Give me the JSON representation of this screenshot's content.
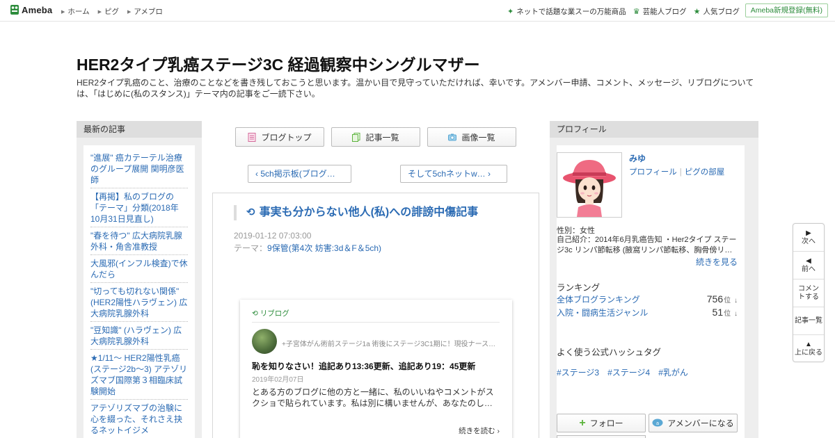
{
  "header": {
    "logo": "Ameba",
    "nav": [
      "ホーム",
      "ピグ",
      "アメブロ"
    ],
    "right_links": [
      {
        "icon": "sparkle-icon",
        "label": "ネットで話題な業スーの万能商品"
      },
      {
        "icon": "crown-icon",
        "label": "芸能人ブログ"
      },
      {
        "icon": "star-icon",
        "label": "人気ブログ"
      }
    ],
    "signup": "Ameba新規登録(無料)"
  },
  "blog": {
    "title": "HER2タイプ乳癌ステージ3C 経過観察中シングルマザー",
    "description": "HER2タイプ乳癌のこと、治療のことなどを書き残しておこうと思います。温かい目で見守っていただければ、幸いです。アメンバー申請、コメント、メッセージ、リブログについては、「はじめに(私のスタンス)」テーマ内の記事をご一読下さい。"
  },
  "recent": {
    "heading": "最新の記事",
    "items": [
      "\"進展\" 癌カテーテル治療のグループ展開 関明彦医師",
      "【再掲】私のブログの「テーマ」分類(2018年10月31日見直し)",
      "\"春を待つ\" 広大病院乳腺外科・角舎准教授",
      "大風邪(インフル検査)で休んだら",
      "\"切っても切れない関係\" (HER2陽性ハラヴェン) 広大病院乳腺外科",
      "\"豆知識\" (ハラヴェン) 広大病院乳腺外科",
      "★1/11～ HER2陽性乳癌(ステージ2b～3) アテゾリズマブ国際第３相臨床試験開始",
      "アテゾリズマブの治験に心を綴った、それさえ抉るネットイジメ"
    ]
  },
  "center": {
    "buttons": [
      {
        "icon": "blog-top-icon",
        "label": "ブログトップ"
      },
      {
        "icon": "article-list-icon",
        "label": "記事一覧"
      },
      {
        "icon": "camera-icon",
        "label": "画像一覧"
      }
    ],
    "prev": "5ch掲示板(ブログ…",
    "next": "そして5chネットw…"
  },
  "article": {
    "title": "事実も分からない他人(私)への誹謗中傷記事",
    "date": "2019-01-12 07:03:00",
    "theme_label": "テーマ：",
    "theme": "9保管(第4次 妨害:3d＆F＆5ch)"
  },
  "reblog": {
    "label": "リブログ",
    "blog_name": "+子宮体がん術前ステージ1a 術後にステージ3C1期に！現役ナース…",
    "title": "恥を知りなさい！追記あり13:36更新、追記あり19：45更新",
    "date": "2019年02月07日",
    "excerpt": "とある方のブログに他の方と一緒に、私のいいねやコメントがスクショで貼られています。私は別に構いませんが、あなたのし…",
    "more": "続きを読む"
  },
  "profile": {
    "heading": "プロフィール",
    "name": "みゆ",
    "link_profile": "プロフィール",
    "link_pig": "ピグの部屋",
    "gender": "性別：女性",
    "intro": "自己紹介：2014年6月乳癌告知 ・Her2タイプ ステージ3c リンパ節転移 (腋窩リンパ節転移、胸骨傍リ…",
    "more": "続きを見る",
    "ranking_heading": "ランキング",
    "rankings": [
      {
        "label": "全体ブログランキング",
        "value": "756",
        "unit": "位",
        "trend": "↓"
      },
      {
        "label": "入院・闘病生活ジャンル",
        "value": "51",
        "unit": "位",
        "trend": "↓"
      }
    ],
    "hashtag_heading": "よく使う公式ハッシュタグ",
    "hashtags": [
      "#ステージ3",
      "#ステージ4",
      "#乳がん"
    ],
    "follow": "フォロー",
    "amember": "アメンバーになる"
  },
  "sidenav": {
    "next": "次へ",
    "prev": "前へ",
    "comment": "コメントする",
    "list": "記事一覧",
    "top": "上に戻る"
  }
}
